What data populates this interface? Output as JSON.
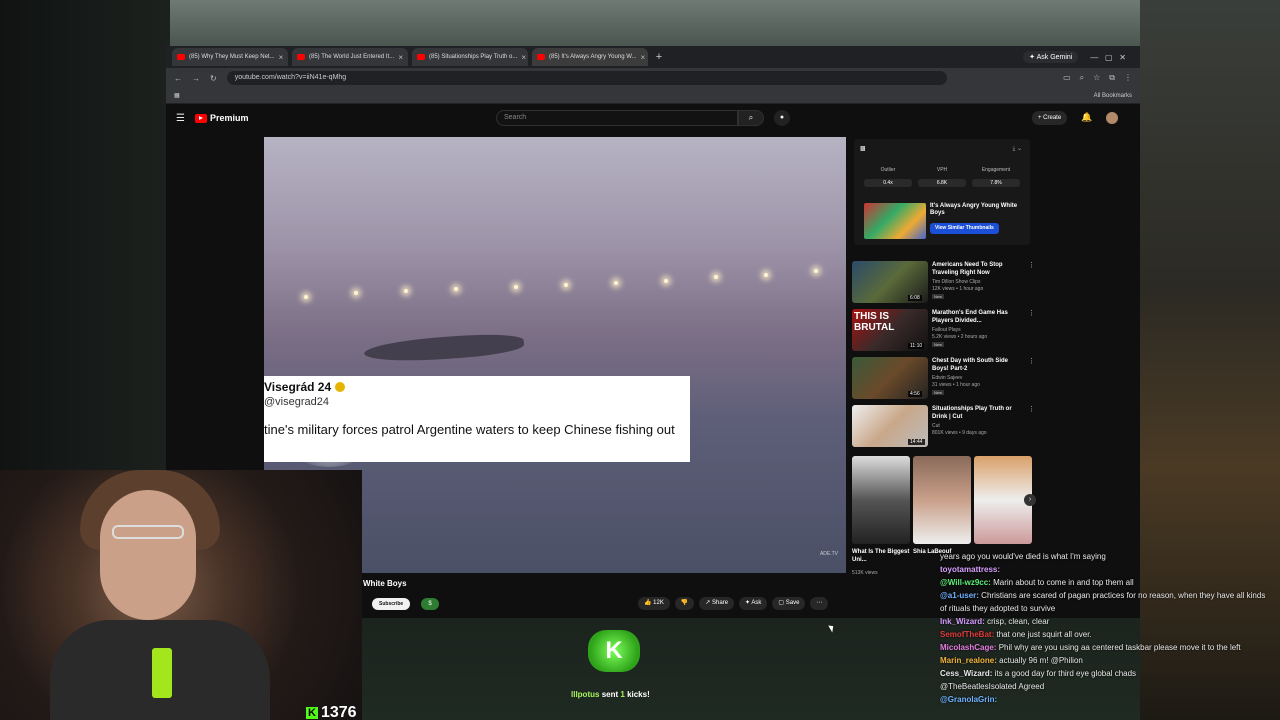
{
  "browser": {
    "tabs": [
      {
        "label": "(85) Why They Must Keep Net..."
      },
      {
        "label": "(85) The World Just Entered It..."
      },
      {
        "label": "(85) Situationships Play Truth o..."
      },
      {
        "label": "(85) It's Always Angry Young W..."
      }
    ],
    "new_tab": "+",
    "ask_gemini": "Ask Gemini",
    "url": "youtube.com/watch?v=iiN41e-qMhg",
    "all_bookmarks": "All Bookmarks"
  },
  "youtube": {
    "brand": "Premium",
    "search_placeholder": "Search",
    "create_label": "Create",
    "notifications_badge": "9+",
    "video_title": "White Boys",
    "subscribe_label": "Subscribe",
    "dollar_label": "$",
    "actions": {
      "likes": "12K",
      "share": "Share",
      "ask": "Ask",
      "save": "Save"
    }
  },
  "tweet": {
    "name": "Visegrád 24",
    "handle": "@visegrad24",
    "text": "tine's military forces patrol Argentine  waters to keep Chinese fishing out"
  },
  "extension": {
    "stats": [
      {
        "label": "Outlier",
        "value": "0.4x"
      },
      {
        "label": "VPH",
        "value": "6.8K"
      },
      {
        "label": "Engagement",
        "value": "7.8%"
      }
    ],
    "thumb_title": "It's Always Angry Young White Boys",
    "similar_button": "View Similar Thumbnails"
  },
  "recommendations": [
    {
      "title": "Americans Need To Stop Traveling Right Now",
      "channel": "Tim Dillon Show Clips",
      "meta": "12K views • 1 hour ago",
      "badge": "New",
      "duration": "6:08"
    },
    {
      "title": "Marathon's End Game Has Players Divided...",
      "channel": "Fallout Plays",
      "meta": "5.2K views • 2 hours ago",
      "badge": "New",
      "duration": "11:10"
    },
    {
      "title": "Chest Day with South Side Boys! Part-2",
      "channel": "Edwin Sajeev",
      "meta": "31 views • 1 hour ago",
      "badge": "New",
      "duration": "4:56"
    },
    {
      "title": "Situationships Play Truth or Drink | Cut",
      "channel": "Cut",
      "meta": "801K views • 9 days ago",
      "badge": "",
      "duration": "14:44"
    }
  ],
  "shorts": {
    "caption": "What Is The Biggest Uni...",
    "views": "513K views",
    "second_caption": "Shia LaBeouf"
  },
  "stream": {
    "kick_count": "1376",
    "alert_user": "lllpotus",
    "alert_middle": "sent",
    "alert_count": "1",
    "alert_end": "kicks!"
  },
  "chat": [
    {
      "user": "",
      "text": "years ago you would've died is what I'm saying",
      "color": "#e8e8e8"
    },
    {
      "user": "toyotamattress:",
      "text": "",
      "color": "#d9a0ff"
    },
    {
      "user": "@Will-wz9cc:",
      "text": "Marin about to come in and top them all",
      "color": "#5cf07a"
    },
    {
      "user": "@a1-user:",
      "text": "Christians are scared of pagan practices for no reason, when they have all kinds of rituals they adopted to survive",
      "color": "#6fb2ff"
    },
    {
      "user": "Ink_Wizard:",
      "text": "crisp, clean, clear",
      "color": "#d59aff"
    },
    {
      "user": "SemofTheBat:",
      "text": "that one just squirt all over.",
      "color": "#e23b3b"
    },
    {
      "user": "MicolashCage:",
      "text": "Phil why are you using aa centered taskbar please move it to the left",
      "color": "#e57de0"
    },
    {
      "user": "Marin_realone:",
      "text": "actually 96 m! @Philion",
      "color": "#f3b53c"
    },
    {
      "user": "Cess_Wizard:",
      "text": "its a good day for third eye global chads",
      "color": "#e8e8e8"
    },
    {
      "user": "",
      "text": "@TheBeatlesIsolated Agreed",
      "color": "#e8e8e8"
    },
    {
      "user": "@GranolaGrin:",
      "text": "",
      "color": "#6fb2ff"
    }
  ]
}
